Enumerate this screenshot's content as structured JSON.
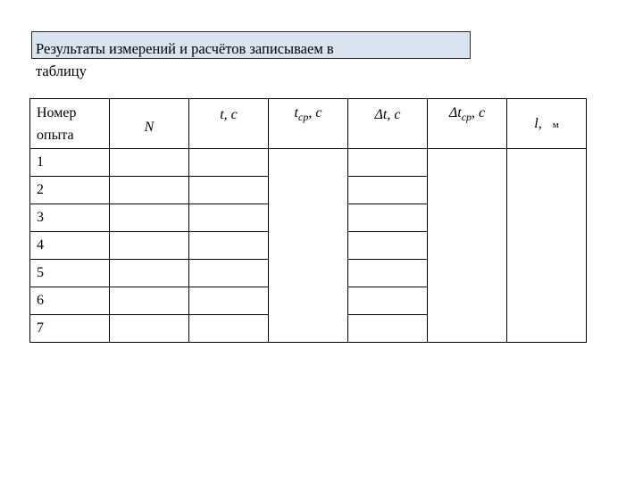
{
  "title": {
    "line1": "Результаты измерений и расчётов записываем в",
    "line2": "таблицу"
  },
  "table": {
    "header": {
      "col0": "Номер опыта",
      "col1": {
        "symbol": "N"
      },
      "col2": {
        "symbol": "t",
        "sep": ",",
        "unit": "c"
      },
      "col3": {
        "symbol": "t",
        "sub": "ср",
        "sep": ",",
        "unit": "c"
      },
      "col4": {
        "symbol": "Δt",
        "sep": ",",
        "unit": "c"
      },
      "col5": {
        "symbol": "Δt",
        "sub": "ср",
        "sep": ",",
        "unit": "c"
      },
      "col6": {
        "symbol": "l",
        "sep": ",",
        "unit": "м"
      }
    },
    "rows": [
      "1",
      "2",
      "3",
      "4",
      "5",
      "6",
      "7"
    ]
  }
}
